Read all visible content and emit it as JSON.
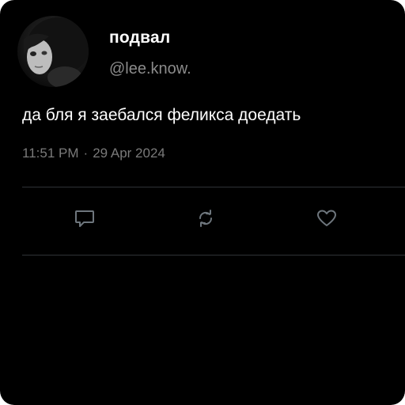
{
  "tweet": {
    "display_name": "подвал",
    "handle": "@lee.know.",
    "text": "да бля я заебался феликса доедать",
    "time": "11:51 PM",
    "separator": "·",
    "date": "29 Apr 2024"
  },
  "actions": {
    "reply_icon": "reply-icon",
    "retweet_icon": "retweet-icon",
    "like_icon": "heart-icon"
  },
  "colors": {
    "background": "#000000",
    "text_primary": "#ffffff",
    "text_secondary": "#8b8b8b",
    "divider": "#2f3336",
    "icon": "#6e767d"
  }
}
